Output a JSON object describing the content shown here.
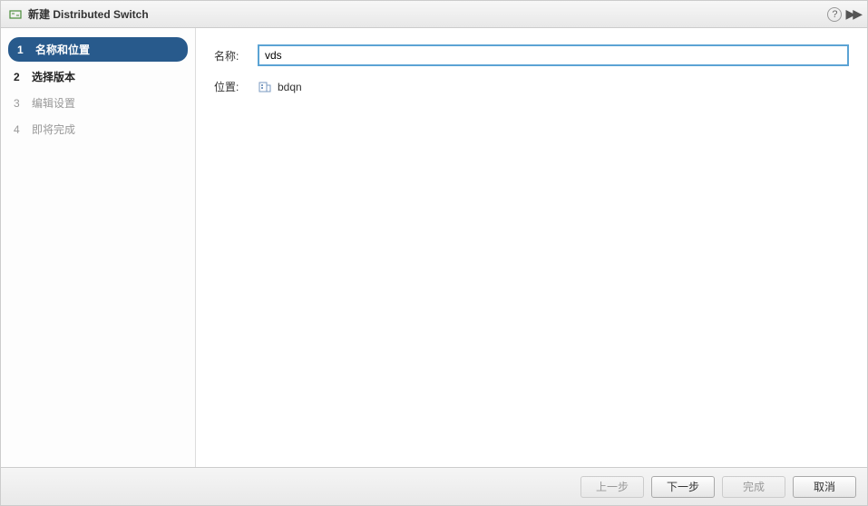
{
  "titlebar": {
    "title": "新建 Distributed Switch"
  },
  "sidebar": {
    "steps": [
      {
        "num": "1",
        "label": "名称和位置"
      },
      {
        "num": "2",
        "label": "选择版本"
      },
      {
        "num": "3",
        "label": "编辑设置"
      },
      {
        "num": "4",
        "label": "即将完成"
      }
    ]
  },
  "form": {
    "name_label": "名称:",
    "name_value": "vds",
    "location_label": "位置:",
    "location_value": "bdqn"
  },
  "footer": {
    "back": "上一步",
    "next": "下一步",
    "finish": "完成",
    "cancel": "取消"
  }
}
